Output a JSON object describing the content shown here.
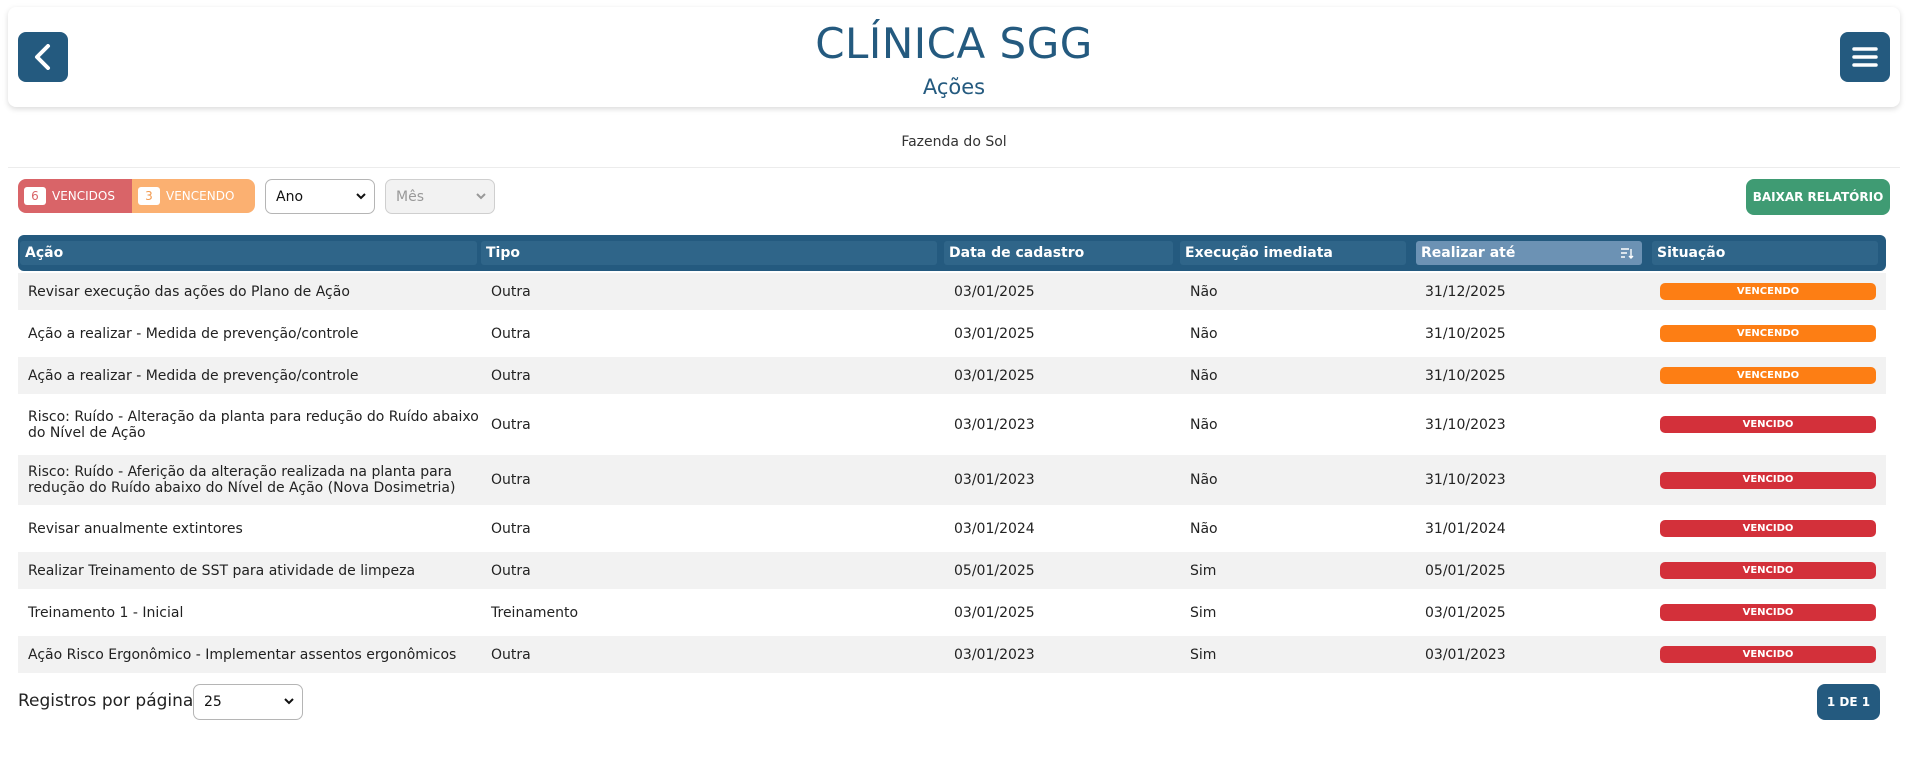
{
  "header": {
    "title": "CLÍNICA SGG",
    "subtitle": "Ações",
    "back_icon": "chevron-left-icon",
    "menu_icon": "hamburger-menu-icon"
  },
  "farm_name": "Fazenda do Sol",
  "filters": {
    "vencidos_count": "6",
    "vencidos_label": "VENCIDOS",
    "vencendo_count": "3",
    "vencendo_label": "VENCENDO",
    "year_select": "Ano",
    "month_select": "Mês",
    "report_button": "BAIXAR RELATÓRIO"
  },
  "table": {
    "columns": [
      "Ação",
      "Tipo",
      "Data de cadastro",
      "Execução imediata",
      "Realizar até",
      "Situação"
    ],
    "sorted_column": "Realizar até",
    "rows": [
      {
        "acao": "Revisar execução das ações do Plano de Ação",
        "tipo": "Outra",
        "data": "03/01/2025",
        "exec": "Não",
        "realizar": "31/12/2025",
        "situacao": "VENCENDO"
      },
      {
        "acao": "Ação a realizar - Medida de prevenção/controle",
        "tipo": "Outra",
        "data": "03/01/2025",
        "exec": "Não",
        "realizar": "31/10/2025",
        "situacao": "VENCENDO"
      },
      {
        "acao": "Ação a realizar - Medida de prevenção/controle",
        "tipo": "Outra",
        "data": "03/01/2025",
        "exec": "Não",
        "realizar": "31/10/2025",
        "situacao": "VENCENDO"
      },
      {
        "acao": "Risco: Ruído - Alteração da planta para redução do Ruído abaixo do Nível de Ação",
        "tipo": "Outra",
        "data": "03/01/2023",
        "exec": "Não",
        "realizar": "31/10/2023",
        "situacao": "VENCIDO"
      },
      {
        "acao": "Risco: Ruído - Aferição da alteração realizada na planta para redução do Ruído abaixo do Nível de Ação (Nova Dosimetria)",
        "tipo": "Outra",
        "data": "03/01/2023",
        "exec": "Não",
        "realizar": "31/10/2023",
        "situacao": "VENCIDO"
      },
      {
        "acao": "Revisar anualmente extintores",
        "tipo": "Outra",
        "data": "03/01/2024",
        "exec": "Não",
        "realizar": "31/01/2024",
        "situacao": "VENCIDO"
      },
      {
        "acao": "Realizar Treinamento de SST para atividade de limpeza",
        "tipo": "Outra",
        "data": "05/01/2025",
        "exec": "Sim",
        "realizar": "05/01/2025",
        "situacao": "VENCIDO"
      },
      {
        "acao": "Treinamento 1 - Inicial",
        "tipo": "Treinamento",
        "data": "03/01/2025",
        "exec": "Sim",
        "realizar": "03/01/2025",
        "situacao": "VENCIDO"
      },
      {
        "acao": "Ação Risco Ergonômico - Implementar assentos ergonômicos",
        "tipo": "Outra",
        "data": "03/01/2023",
        "exec": "Sim",
        "realizar": "03/01/2023",
        "situacao": "VENCIDO"
      }
    ]
  },
  "pagination": {
    "per_page_label": "Registros por página:",
    "per_page_value": "25",
    "page_label": "1 DE 1"
  },
  "colors": {
    "primary": "#245a7f",
    "green": "#3f9b73",
    "status_orange": "#fd7e14",
    "status_red": "#d3303a"
  }
}
